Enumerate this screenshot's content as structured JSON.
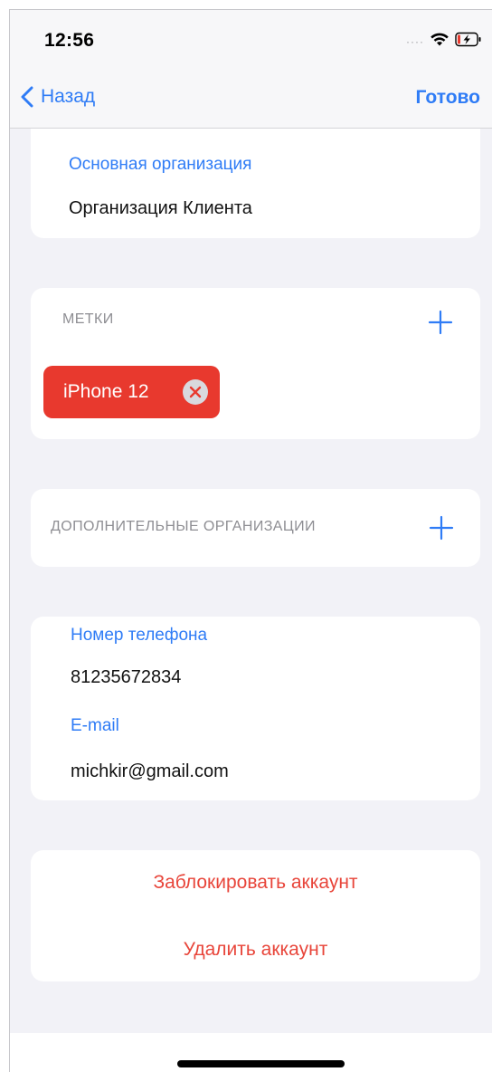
{
  "status_bar": {
    "time": "12:56"
  },
  "nav": {
    "back_label": "Назад",
    "done_label": "Готово"
  },
  "organization": {
    "label": "Основная организация",
    "value": "Организация Клиента"
  },
  "tags": {
    "header": "МЕТКИ",
    "items": [
      {
        "label": "iPhone 12",
        "color": "#e8392e"
      }
    ]
  },
  "additional_orgs": {
    "header": "ДОПОЛНИТЕЛЬНЫЕ ОРГАНИЗАЦИИ"
  },
  "contact": {
    "phone_label": "Номер телефона",
    "phone_value": "81235672834",
    "email_label": "E-mail",
    "email_value": "michkir@gmail.com"
  },
  "actions": {
    "block_label": "Заблокировать аккаунт",
    "delete_label": "Удалить аккаунт"
  },
  "colors": {
    "accent": "#2f7cf6",
    "destructive": "#e8453a",
    "background": "#f2f2f7"
  }
}
